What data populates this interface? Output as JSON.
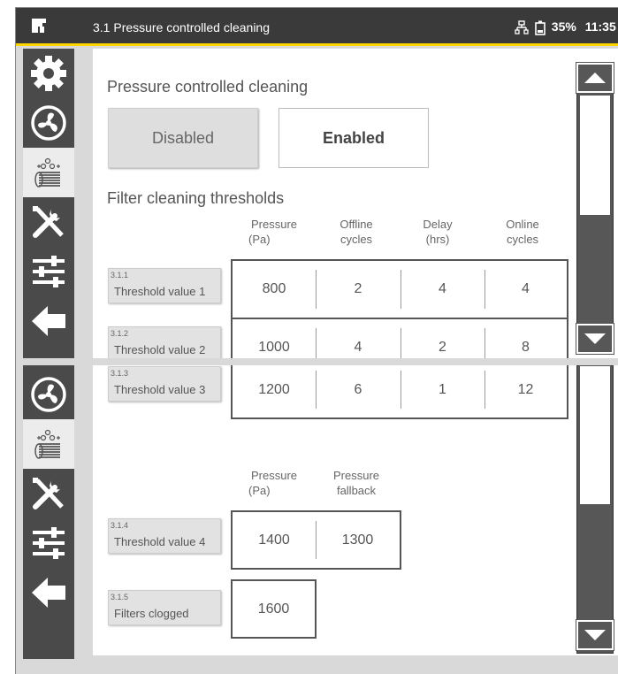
{
  "header": {
    "title": "3.1 Pressure controlled cleaning",
    "battery": "35%",
    "time": "11:35"
  },
  "sidebar": {
    "items": [
      {
        "icon": "gear-icon"
      },
      {
        "icon": "fan-icon"
      },
      {
        "icon": "filter-cleaning-icon"
      },
      {
        "icon": "tools-icon"
      },
      {
        "icon": "sliders-icon"
      },
      {
        "icon": "back-arrow-icon"
      }
    ]
  },
  "top": {
    "section_title": "Pressure controlled cleaning",
    "toggle": {
      "disabled": "Disabled",
      "enabled": "Enabled",
      "selected": "Enabled"
    },
    "thresholds_title": "Filter cleaning thresholds",
    "columns": [
      {
        "l1": "Pressure",
        "l2": "(Pa)"
      },
      {
        "l1": "Offline",
        "l2": "cycles"
      },
      {
        "l1": "Delay",
        "l2": "(hrs)"
      },
      {
        "l1": "Online",
        "l2": "cycles"
      }
    ],
    "rows": [
      {
        "idx": "3.1.1",
        "label": "Threshold value 1",
        "values": [
          "800",
          "2",
          "4",
          "4"
        ]
      },
      {
        "idx": "3.1.2",
        "label": "Threshold value 2",
        "values": [
          "1000",
          "4",
          "2",
          "8"
        ]
      }
    ]
  },
  "bottom": {
    "row3": {
      "idx": "3.1.3",
      "label": "Threshold value 3",
      "values": [
        "1200",
        "6",
        "1",
        "12"
      ]
    },
    "columns": [
      {
        "l1": "Pressure",
        "l2": "(Pa)"
      },
      {
        "l1": "Pressure",
        "l2": "fallback"
      }
    ],
    "row4": {
      "idx": "3.1.4",
      "label": "Threshold value 4",
      "values": [
        "1400",
        "1300"
      ]
    },
    "row5": {
      "idx": "3.1.5",
      "label": "Filters clogged",
      "values": [
        "1600"
      ]
    }
  },
  "colors": {
    "header_bg": "#3a3a3a",
    "accent": "#ffd500",
    "sidebar": "#4a4a4a"
  }
}
